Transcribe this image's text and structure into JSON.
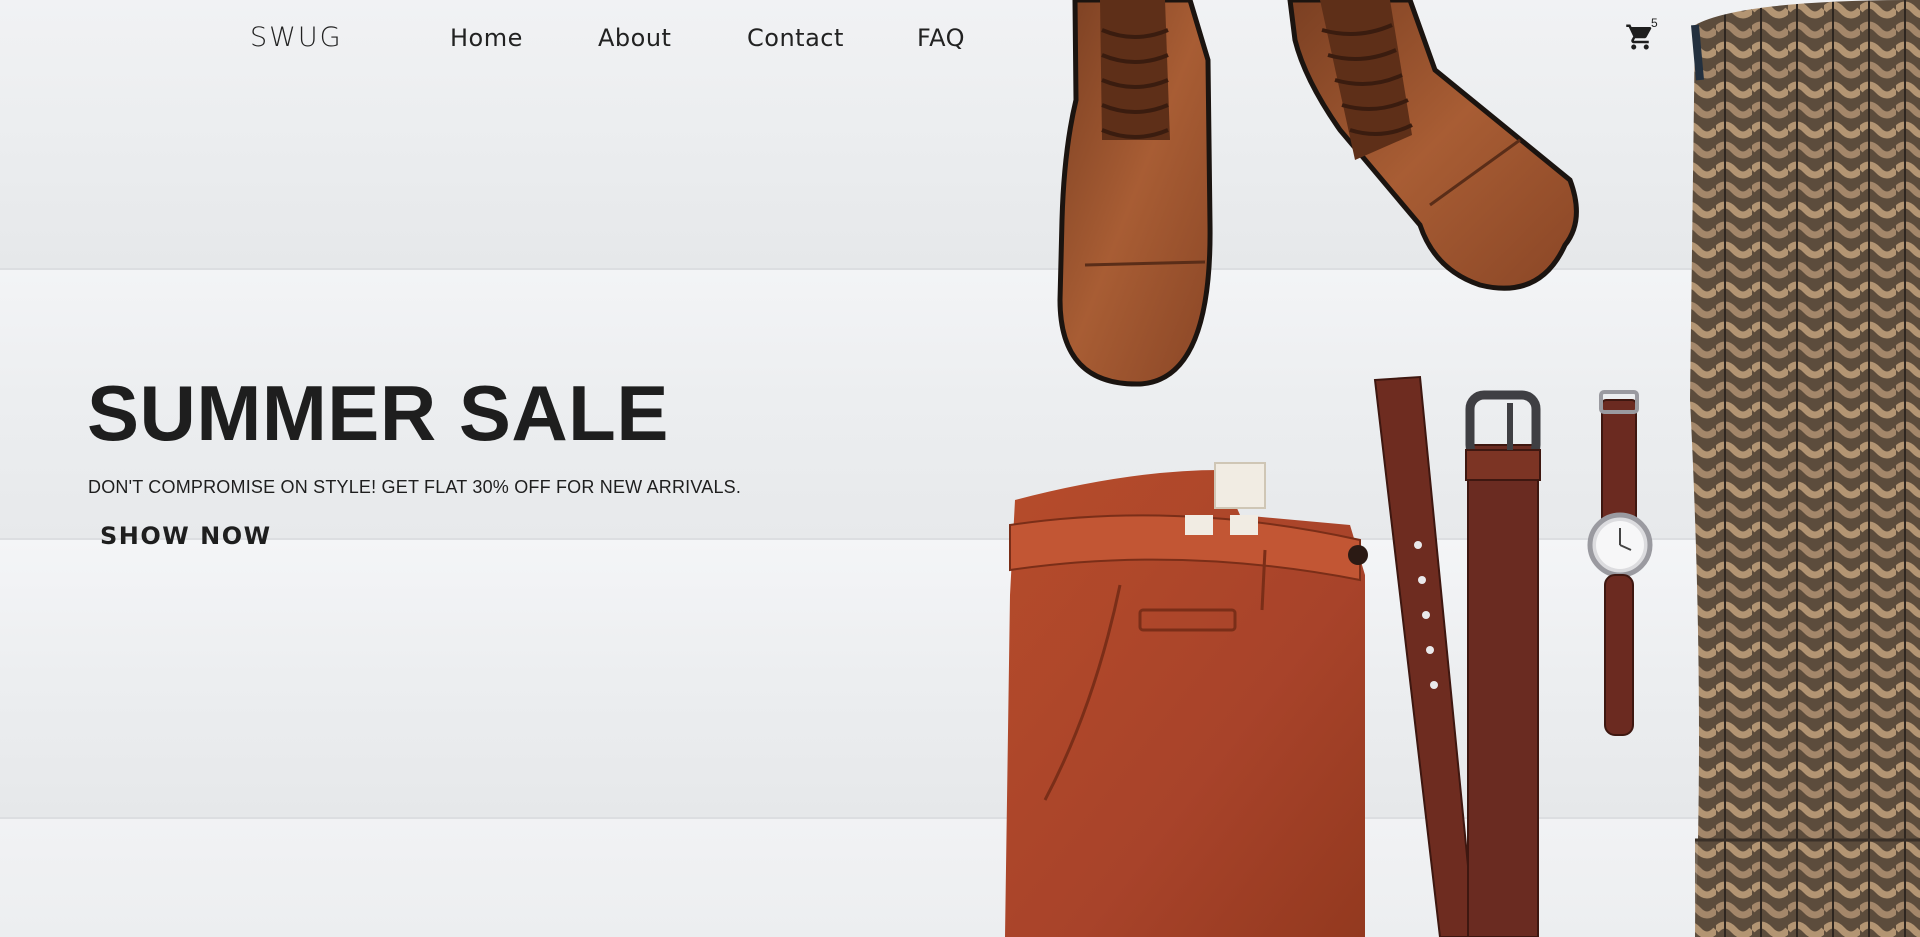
{
  "nav": {
    "logo": "SWUG",
    "links": [
      "Home",
      "About",
      "Contact",
      "FAQ"
    ],
    "cart_count": "5"
  },
  "hero": {
    "title": "SUMMER SALE",
    "subtitle": "DON'T COMPROMISE ON STYLE! GET FLAT 30% OFF FOR NEW ARRIVALS.",
    "cta": "SHOW NOW"
  },
  "products": [
    "boots-image",
    "pants-image",
    "belt-image",
    "watch-image",
    "sweater-image"
  ],
  "colors": {
    "text": "#1e1e1e",
    "background": "#eeeff1",
    "leather": "#9a5530",
    "pants": "#b0482a",
    "belt": "#6b2d22",
    "sweater": "#6e5d4a"
  }
}
